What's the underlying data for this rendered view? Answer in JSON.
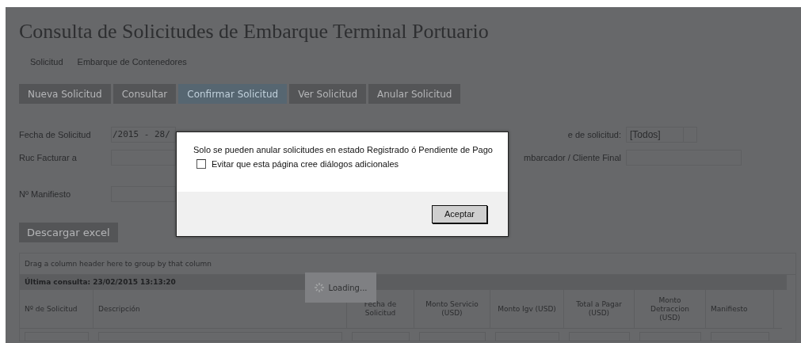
{
  "page": {
    "title": "Consulta de Solicitudes de Embarque Terminal Portuario",
    "breadcrumb": [
      "Solicitud",
      "Embarque de Contenedores"
    ]
  },
  "toolbar": [
    {
      "label": "Nueva Solicitud",
      "selected": false
    },
    {
      "label": "Consultar",
      "selected": false
    },
    {
      "label": "Confirmar Solicitud",
      "selected": true
    },
    {
      "label": "Ver Solicitud",
      "selected": false
    },
    {
      "label": "Anular Solicitud",
      "selected": false
    }
  ],
  "filters_left": [
    {
      "label": "Fecha de Solicitud",
      "value": "/2015 - 28/"
    },
    {
      "label": "Ruc Facturar a"
    },
    {
      "label": "Nº Manifiesto"
    }
  ],
  "filters_right": [
    {
      "label": "e de solicitud:",
      "kind": "select",
      "value": "[Todos]"
    },
    {
      "label": "mbarcador / Cliente Final",
      "kind": "input"
    }
  ],
  "export_button": "Descargar excel",
  "grid": {
    "group_hint": "Drag a column header here to group by that column",
    "last_query": "Última consulta: 23/02/2015 13:13:20",
    "columns": [
      "Nº de Solicitud",
      "Descripción",
      "Fecha de Solicitud",
      "Monto Servicio (USD)",
      "Monto Igv (USD)",
      "Total a Pagar (USD)",
      "Monto Detraccion (USD)",
      "Manifiesto"
    ]
  },
  "loading": {
    "label": "Loading..."
  },
  "dialog": {
    "message": "Solo se pueden anular solicitudes en estado Registrado ó Pendiente de Pago",
    "checkbox": {
      "label": "Evitar que esta página cree diálogos adicionales",
      "checked": false
    },
    "button": "Aceptar"
  }
}
